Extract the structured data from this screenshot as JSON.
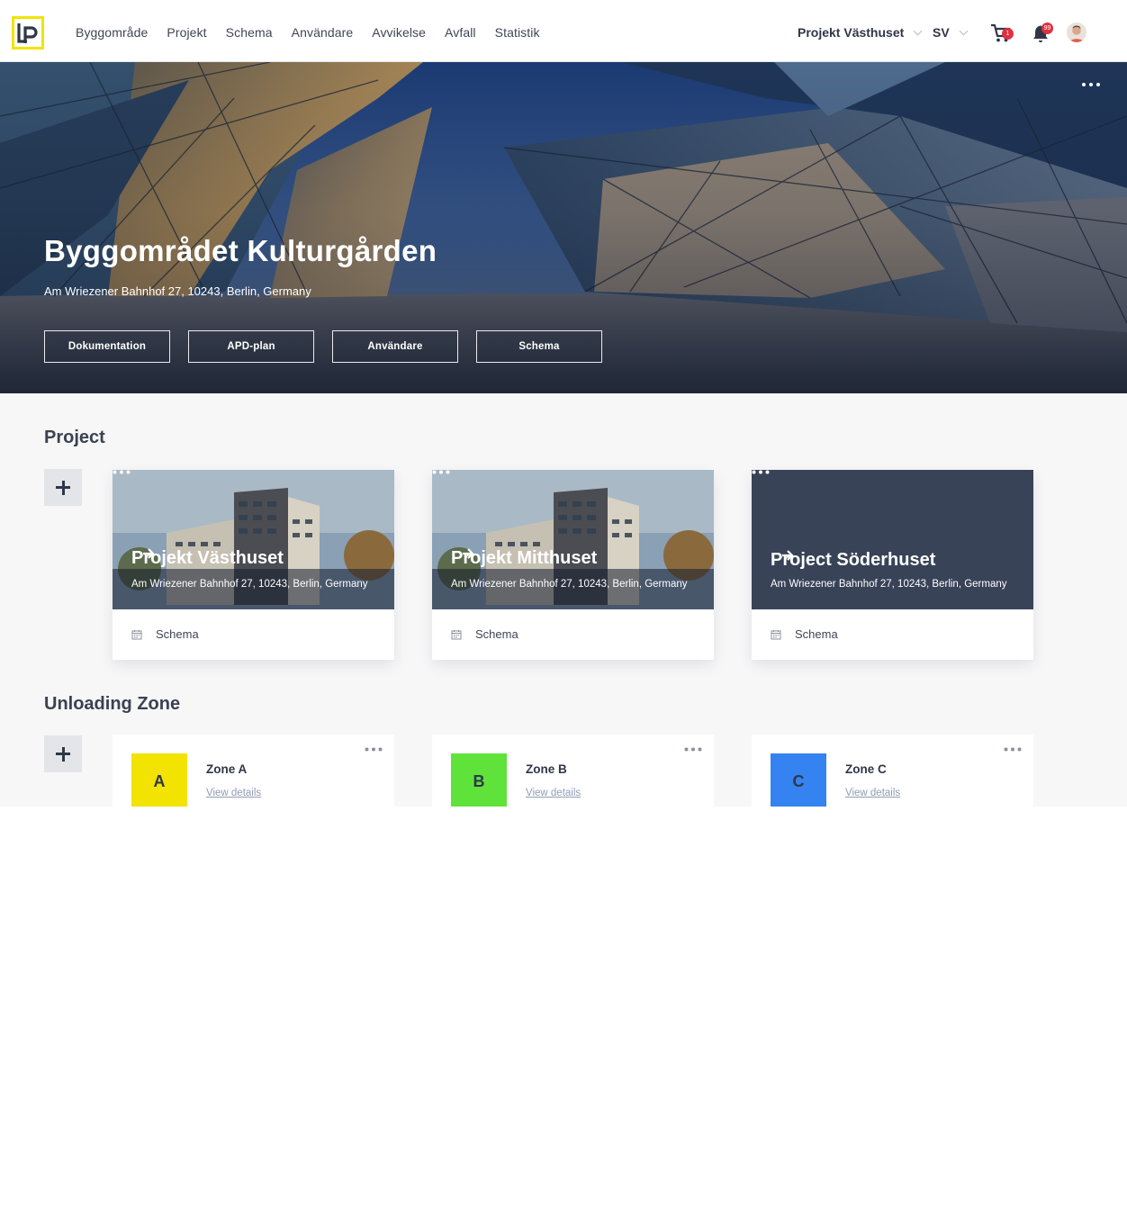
{
  "nav": {
    "items": [
      "Byggområde",
      "Projekt",
      "Schema",
      "Användare",
      "Avvikelse",
      "Avfall",
      "Statistik"
    ],
    "project_selector": "Projekt Västhuset",
    "language": "SV",
    "cart_badge": "1",
    "notifications_badge": "99"
  },
  "hero": {
    "title": "Byggområdet Kulturgården",
    "address": "Am Wriezener Bahnhof 27, 10243, Berlin, Germany",
    "buttons": [
      "Dokumentation",
      "APD-plan",
      "Användare",
      "Schema"
    ]
  },
  "projects": {
    "heading": "Project",
    "cards": [
      {
        "title": "Projekt Västhuset",
        "address": "Am Wriezener Bahnhof 27, 10243, Berlin, Germany",
        "footer": "Schema"
      },
      {
        "title": "Projekt Mitthuset",
        "address": "Am Wriezener Bahnhof 27, 10243, Berlin, Germany",
        "footer": "Schema"
      },
      {
        "title": "Project Söderhuset",
        "address": "Am Wriezener Bahnhof 27, 10243, Berlin, Germany",
        "footer": "Schema"
      }
    ]
  },
  "zones": {
    "heading": "Unloading Zone",
    "cards": [
      {
        "letter": "A",
        "name": "Zone A",
        "link": "View details",
        "color": "#f2e300"
      },
      {
        "letter": "B",
        "name": "Zone B",
        "link": "View details",
        "color": "#5fe33a"
      },
      {
        "letter": "C",
        "name": "Zone C",
        "link": "View details",
        "color": "#3583f0"
      }
    ]
  },
  "colors": {
    "brand_yellow": "#f2e300",
    "text_dark": "#2f3747",
    "badge_red": "#e0303f"
  }
}
